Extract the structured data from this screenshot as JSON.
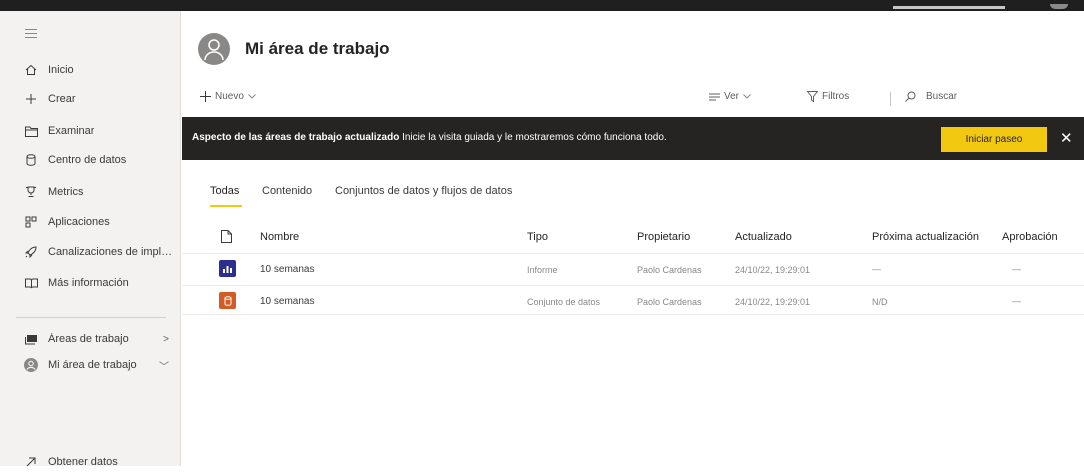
{
  "sidebar": {
    "items": [
      {
        "label": "Inicio",
        "icon": "home-icon"
      },
      {
        "label": "Crear",
        "icon": "plus-icon"
      },
      {
        "label": "Examinar",
        "icon": "folder-icon"
      },
      {
        "label": "Centro de datos",
        "icon": "database-icon"
      },
      {
        "label": "Metrics",
        "icon": "trophy-icon"
      },
      {
        "label": "Aplicaciones",
        "icon": "apps-icon"
      },
      {
        "label": "Canalizaciones de implem...",
        "icon": "rocket-icon"
      },
      {
        "label": "Más información",
        "icon": "book-icon"
      },
      {
        "label": "Áreas de trabajo",
        "icon": "workspaces-icon",
        "chevron": ">"
      },
      {
        "label": "Mi área de trabajo",
        "icon": "user-avatar-icon",
        "chevron": "﹀"
      },
      {
        "label": "Obtener datos",
        "icon": "arrow-upright-icon"
      }
    ]
  },
  "header": {
    "title": "Mi área de trabajo"
  },
  "toolbar": {
    "new_label": "Nuevo",
    "view_label": "Ver",
    "filters_label": "Filtros",
    "search_label": "Buscar"
  },
  "banner": {
    "bold_text": "Aspecto de las áreas de trabajo actualizado",
    "text": "Inicie la visita guiada y le mostraremos cómo funciona todo.",
    "button_label": "Iniciar paseo",
    "close_label": "✕"
  },
  "tabs": [
    {
      "label": "Todas",
      "active": true
    },
    {
      "label": "Contenido",
      "active": false
    },
    {
      "label": "Conjuntos de datos y flujos de datos",
      "active": false
    }
  ],
  "table": {
    "columns": [
      "Nombre",
      "Tipo",
      "Propietario",
      "Actualizado",
      "Próxima actualización",
      "Aprobación"
    ],
    "rows": [
      {
        "name": "10 semanas",
        "type": "Informe",
        "owner": "Paolo Cardenas",
        "updated": "24/10/22, 19:29:01",
        "next": "—",
        "approval": "—",
        "icon": "report-icon",
        "icon_color": "#2b2f8f"
      },
      {
        "name": "10 semanas",
        "type": "Conjunto de datos",
        "owner": "Paolo Cardenas",
        "updated": "24/10/22, 19:29:01",
        "next": "N/D",
        "approval": "—",
        "icon": "dataset-icon",
        "icon_color": "#d35b24"
      }
    ]
  },
  "colors": {
    "accent": "#f2c811",
    "banner_bg": "#252423",
    "sidebar_bg": "#f3f2f1"
  }
}
